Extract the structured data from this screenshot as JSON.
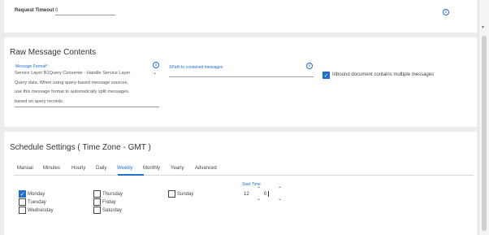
{
  "request_timeout": {
    "label": "Request Timeout",
    "value": "0"
  },
  "raw": {
    "title": "Raw Message Contents",
    "message_format": {
      "label": "Message Format*",
      "lines": [
        "Service Layer B1Query Converter - Handle Service Layer",
        "Query data. When using query-based message sources,",
        "use this message format to automatically split messages",
        "based on query records."
      ]
    },
    "xpath": {
      "label": "XPath to contained messages",
      "value": ""
    },
    "inbound": {
      "label": "Inbound document contains multiple messages",
      "checked": true
    }
  },
  "schedule": {
    "title": "Schedule Settings ( Time Zone - GMT )",
    "tabs": [
      "Manual",
      "Minutes",
      "Hourly",
      "Daily",
      "Weekly",
      "Monthly",
      "Yearly",
      "Advanced"
    ],
    "active_tab": "Weekly",
    "days": {
      "monday": {
        "label": "Monday",
        "checked": true
      },
      "tuesday": {
        "label": "Tuesday",
        "checked": false
      },
      "wednesday": {
        "label": "Wednesday",
        "checked": false
      },
      "thursday": {
        "label": "Thursday",
        "checked": false
      },
      "friday": {
        "label": "Friday",
        "checked": false
      },
      "saturday": {
        "label": "Saturday",
        "checked": false
      },
      "sunday": {
        "label": "Sunday",
        "checked": false
      }
    },
    "start_time": {
      "label": "Start Time",
      "hour": "12",
      "minute": "0"
    }
  },
  "colors": {
    "accent": "#1e6fd0",
    "background": "#ececec",
    "panel": "#ffffff"
  },
  "icons": {
    "info": "info-circle-icon",
    "check": "check-icon",
    "chevron": "chevron-icon"
  }
}
